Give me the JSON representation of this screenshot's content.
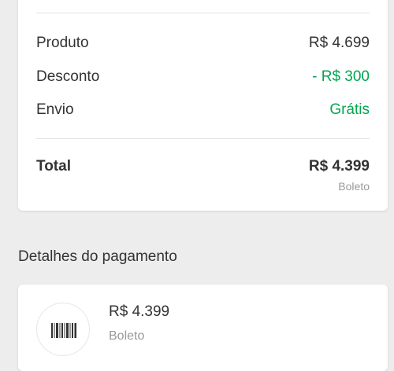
{
  "summary": {
    "rows": [
      {
        "label": "Produto",
        "value": "R$ 4.699"
      },
      {
        "label": "Desconto",
        "value": "- R$ 300"
      },
      {
        "label": "Envio",
        "value": "Grátis"
      }
    ],
    "total": {
      "label": "Total",
      "value": "R$ 4.399",
      "method": "Boleto"
    }
  },
  "payment_details": {
    "title": "Detalhes do pagamento",
    "amount": "R$ 4.399",
    "method": "Boleto",
    "icon": "barcode-icon"
  },
  "colors": {
    "background": "#ededed",
    "card": "#ffffff",
    "positive": "#00a650",
    "muted": "#999999",
    "text": "#333333"
  }
}
